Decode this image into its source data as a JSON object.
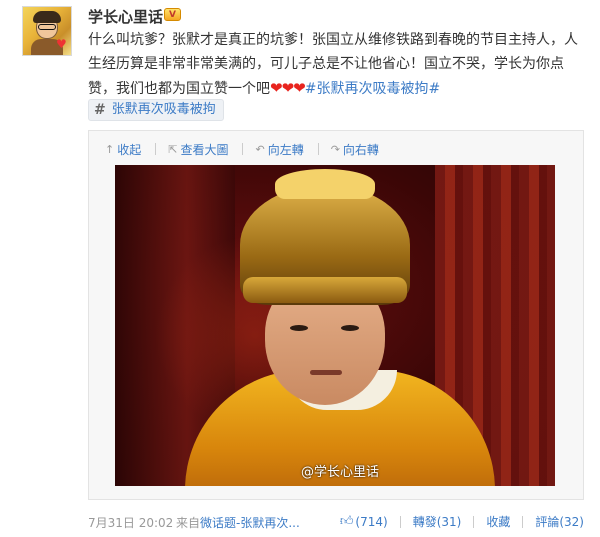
{
  "user": {
    "name": "学长心里话",
    "badge": "V"
  },
  "post": {
    "text_main": "什么叫坑爹？张默才是真正的坑爹！张国立从维修铁路到春晚的节目主持人，人生经历算是非常非常美满的，可儿子总是不让他省心！国立不哭，学长为你点赞，我们也都为国立赞一个吧",
    "hearts": "❤❤❤",
    "hashtag": "#张默再次吸毒被拘#",
    "topic_chip": "张默再次吸毒被拘"
  },
  "media_toolbar": {
    "collapse": "收起",
    "view_large": "查看大圖",
    "rotate_left": "向左轉",
    "rotate_right": "向右轉"
  },
  "photo": {
    "watermark": "@学长心里话"
  },
  "footer": {
    "time": "7月31日 20:02",
    "from_prefix": "来自",
    "source": "微话题-张默再次...",
    "likes": "(714)",
    "repost": "轉發(31)",
    "favorite": "收藏",
    "comment": "評論(32)"
  }
}
